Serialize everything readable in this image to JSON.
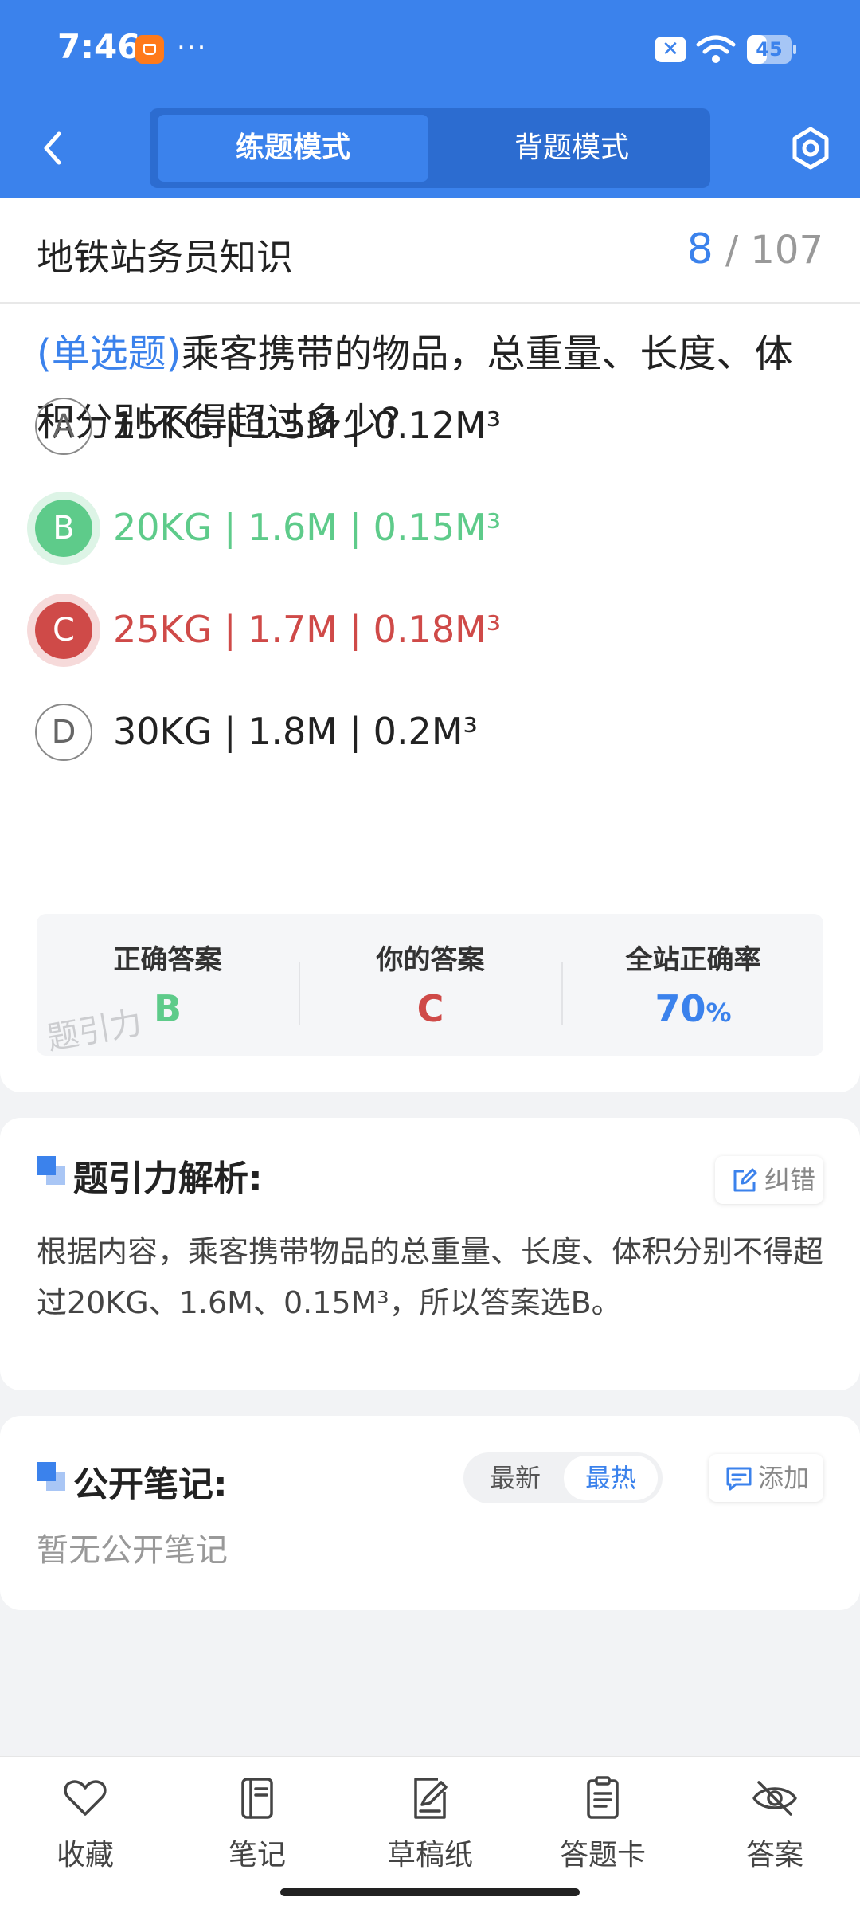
{
  "status_bar": {
    "time": "7:46",
    "dots": "···",
    "x_badge": "✕",
    "battery": "45",
    "battery_level": 0.45
  },
  "nav": {
    "tabs": [
      {
        "label": "练题模式",
        "active": true
      },
      {
        "label": "背题模式",
        "active": false
      }
    ]
  },
  "subject": {
    "title": "地铁站务员知识",
    "current": "8",
    "total": "/ 107"
  },
  "question": {
    "type_label": "(单选题)",
    "text": "乘客携带的物品，总重量、长度、体积分别不得超过多少?",
    "options": [
      {
        "letter": "A",
        "text": "15KG | 1.5M | 0.12M³",
        "state": "normal"
      },
      {
        "letter": "B",
        "text": "20KG | 1.6M | 0.15M³",
        "state": "correct"
      },
      {
        "letter": "C",
        "text": "25KG | 1.7M | 0.18M³",
        "state": "wrong"
      },
      {
        "letter": "D",
        "text": "30KG | 1.8M | 0.2M³",
        "state": "normal"
      }
    ]
  },
  "answer_summary": {
    "correct_label": "正确答案",
    "correct_value": "B",
    "yours_label": "你的答案",
    "yours_value": "C",
    "rate_label": "全站正确率",
    "rate_value": "70",
    "rate_unit": "%",
    "watermark": "题引力"
  },
  "analysis": {
    "title": "题引力解析:",
    "report_label": "纠错",
    "text": "根据内容，乘客携带物品的总重量、长度、体积分别不得超过20KG、1.6M、0.15M³，所以答案选B。"
  },
  "notes": {
    "title": "公开笔记:",
    "sort_latest": "最新",
    "sort_hot": "最热",
    "add_label": "添加",
    "empty_text": "暂无公开笔记"
  },
  "bottom_bar": {
    "items": [
      {
        "label": "收藏",
        "icon": "heart-icon"
      },
      {
        "label": "笔记",
        "icon": "notebook-icon"
      },
      {
        "label": "草稿纸",
        "icon": "draft-paper-icon"
      },
      {
        "label": "答题卡",
        "icon": "answer-sheet-icon"
      },
      {
        "label": "答案",
        "icon": "eye-off-icon"
      }
    ]
  },
  "colors": {
    "primary": "#3b82ec",
    "correct": "#5ecb8a",
    "wrong": "#cf4a48"
  }
}
